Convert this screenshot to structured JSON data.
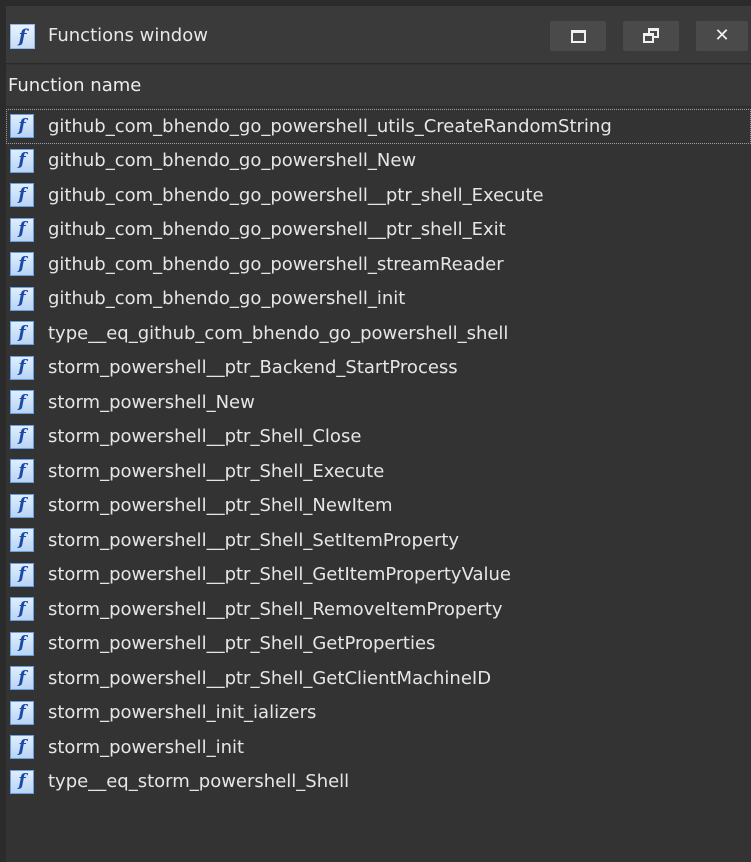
{
  "window": {
    "title": "Functions window",
    "icon": "function-icon",
    "controls": {
      "maximize": "maximize-icon",
      "restore": "restore-icon",
      "close": "close-icon"
    }
  },
  "list": {
    "column_header": "Function name",
    "items": [
      {
        "name": "github_com_bhendo_go_powershell_utils_CreateRandomString",
        "selected": true
      },
      {
        "name": "github_com_bhendo_go_powershell_New"
      },
      {
        "name": "github_com_bhendo_go_powershell__ptr_shell_Execute"
      },
      {
        "name": "github_com_bhendo_go_powershell__ptr_shell_Exit"
      },
      {
        "name": "github_com_bhendo_go_powershell_streamReader"
      },
      {
        "name": "github_com_bhendo_go_powershell_init"
      },
      {
        "name": "type__eq_github_com_bhendo_go_powershell_shell"
      },
      {
        "name": "storm_powershell__ptr_Backend_StartProcess"
      },
      {
        "name": "storm_powershell_New"
      },
      {
        "name": "storm_powershell__ptr_Shell_Close"
      },
      {
        "name": "storm_powershell__ptr_Shell_Execute"
      },
      {
        "name": "storm_powershell__ptr_Shell_NewItem"
      },
      {
        "name": "storm_powershell__ptr_Shell_SetItemProperty"
      },
      {
        "name": "storm_powershell__ptr_Shell_GetItemPropertyValue"
      },
      {
        "name": "storm_powershell__ptr_Shell_RemoveItemProperty"
      },
      {
        "name": "storm_powershell__ptr_Shell_GetProperties"
      },
      {
        "name": "storm_powershell__ptr_Shell_GetClientMachineID"
      },
      {
        "name": "storm_powershell_init_ializers"
      },
      {
        "name": "storm_powershell_init"
      },
      {
        "name": "type__eq_storm_powershell_Shell"
      }
    ]
  },
  "colors": {
    "background": "#333333",
    "titlebar": "#3a3a3a",
    "text": "#e6e6e6",
    "icon_blue": "#1a4aa8"
  }
}
